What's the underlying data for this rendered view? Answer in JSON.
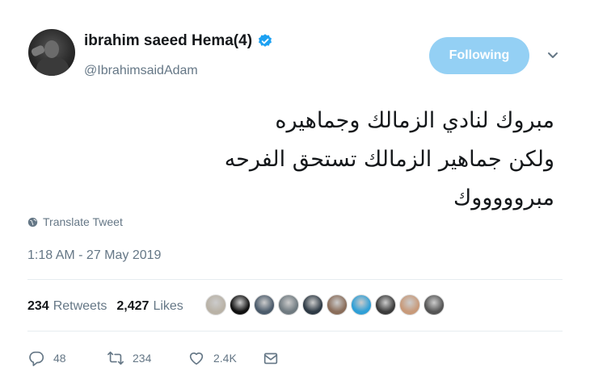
{
  "author": {
    "display_name": "ibrahim saeed Hema(4)",
    "handle": "@IbrahimsaidAdam",
    "verified": true,
    "avatar_icon": "profile-photo"
  },
  "follow_button": {
    "label": "Following",
    "color": "#94d0f4"
  },
  "menu": {
    "icon": "chevron-down-icon"
  },
  "tweet": {
    "lines": [
      "مبروك لنادي الزمالك وجماهيره",
      "ولكن جماهير الزمالك تستحق الفرحه",
      "مبروووووك"
    ]
  },
  "translate": {
    "label": "Translate Tweet",
    "icon": "globe-icon"
  },
  "timestamp": "1:18 AM - 27 May 2019",
  "stats": {
    "retweets_count": "234",
    "retweets_label": "Retweets",
    "likes_count": "2,427",
    "likes_label": "Likes"
  },
  "likers": [
    {
      "color": "#b9b2a6"
    },
    {
      "color": "#111111"
    },
    {
      "color": "#4b5b6b"
    },
    {
      "color": "#6f7a80"
    },
    {
      "color": "#2e3a45"
    },
    {
      "color": "#8a6d5a"
    },
    {
      "color": "#2f9fd6"
    },
    {
      "color": "#3b3b3b"
    },
    {
      "color": "#c89a7a"
    },
    {
      "color": "#555555"
    }
  ],
  "actions": {
    "reply": {
      "icon": "reply-icon",
      "count": "48"
    },
    "retweet": {
      "icon": "retweet-icon",
      "count": "234"
    },
    "like": {
      "icon": "heart-icon",
      "count": "2.4K"
    },
    "message": {
      "icon": "envelope-icon"
    }
  },
  "colors": {
    "accent": "#1da1f2",
    "muted": "#657786"
  }
}
